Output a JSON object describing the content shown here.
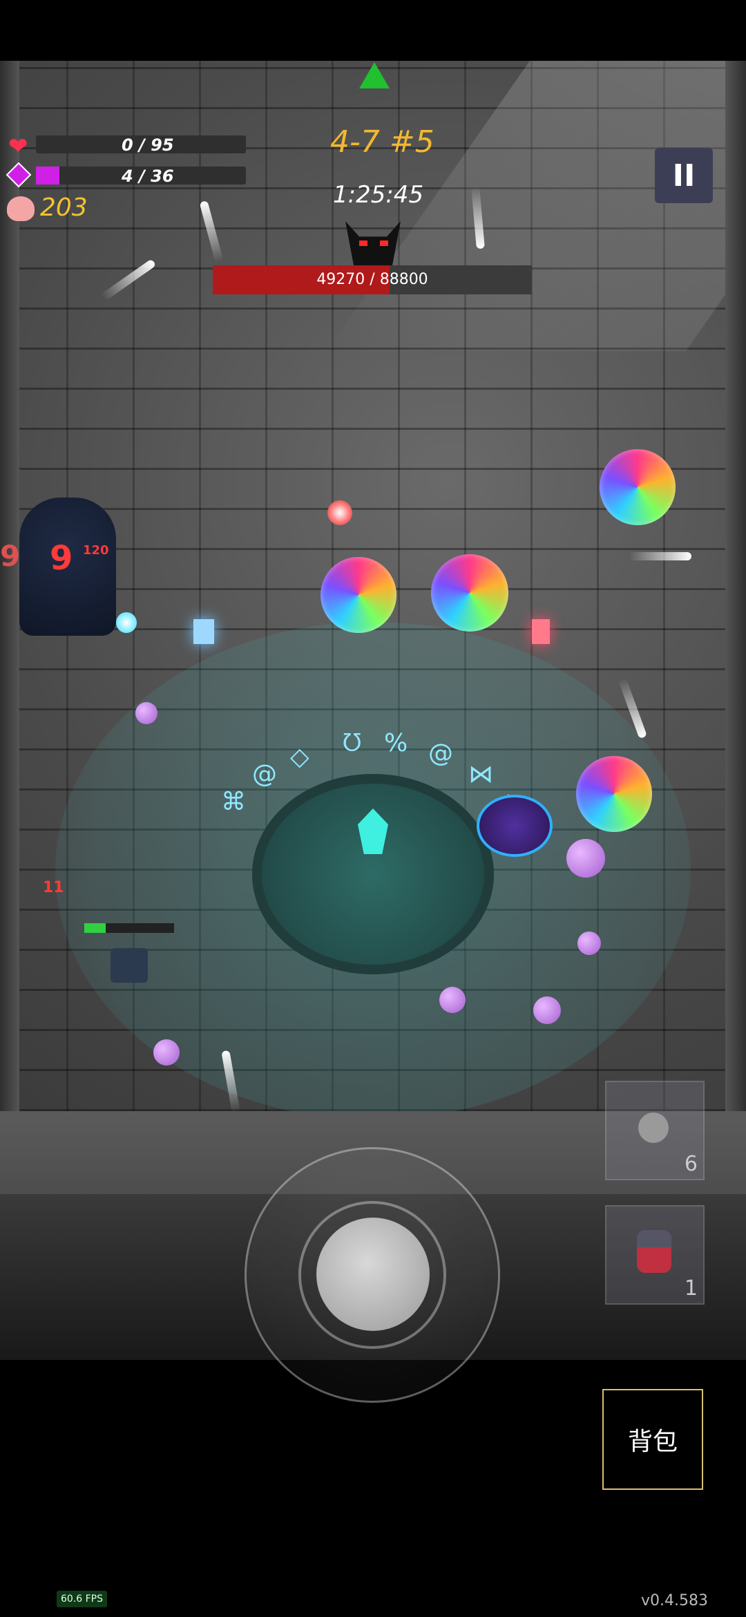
{
  "hud": {
    "hp_text": "0 / 95",
    "mana_text": "4 / 36",
    "coins": "203",
    "stage": "4-7 #5",
    "timer": "1:25:45",
    "pause_label": "II"
  },
  "boss": {
    "hp_text": "49270 / 88800",
    "hp_fraction": 0.555
  },
  "mana_fraction": 0.111,
  "damage_numbers": [
    "9",
    "9",
    "120",
    "11"
  ],
  "items": [
    {
      "name": "grenade",
      "count": "6"
    },
    {
      "name": "potion",
      "count": "1"
    }
  ],
  "bag_label": "背包",
  "fps": "60.6 FPS",
  "version": "v0.4.583",
  "colors": {
    "stage": "#f2b830",
    "boss_hp": "#b01a1a",
    "mana": "#d020e8",
    "heart": "#ff3050"
  }
}
